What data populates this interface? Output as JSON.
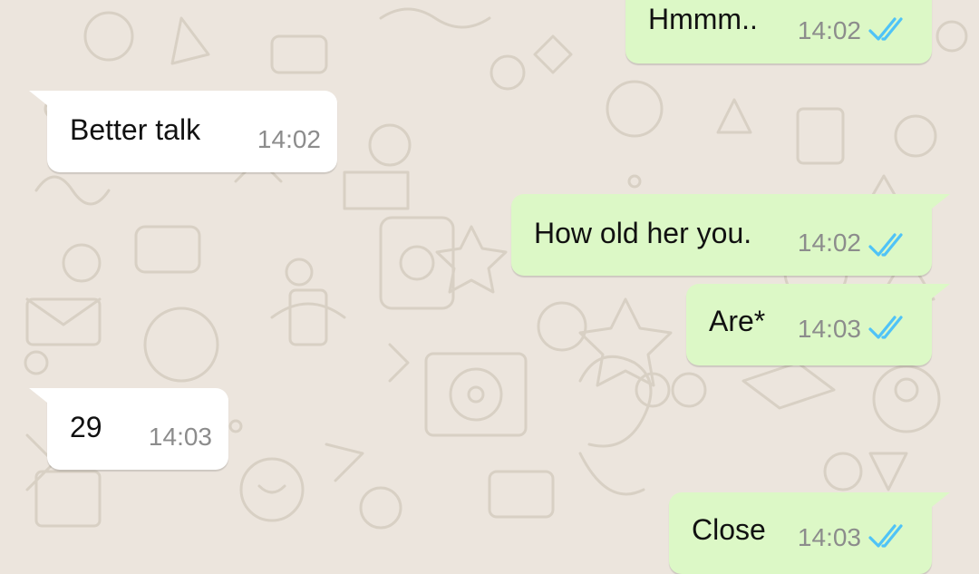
{
  "colors": {
    "wallpaper": "#ece5dd",
    "incoming_bubble": "#ffffff",
    "outgoing_bubble": "#dcf8c6",
    "timestamp": "#8c8c8c",
    "read_ticks": "#4fc3f7"
  },
  "messages": [
    {
      "direction": "outgoing",
      "text": "Hmmm..",
      "time": "14:02",
      "status_icon": "double-check-read-icon"
    },
    {
      "direction": "incoming",
      "text": "Better talk",
      "time": "14:02"
    },
    {
      "direction": "outgoing",
      "text": "How old her you.",
      "time": "14:02",
      "status_icon": "double-check-read-icon"
    },
    {
      "direction": "outgoing",
      "text": "Are*",
      "time": "14:03",
      "status_icon": "double-check-read-icon"
    },
    {
      "direction": "incoming",
      "text": "29",
      "time": "14:03"
    },
    {
      "direction": "outgoing",
      "text": "Close",
      "time": "14:03",
      "status_icon": "double-check-read-icon"
    }
  ]
}
